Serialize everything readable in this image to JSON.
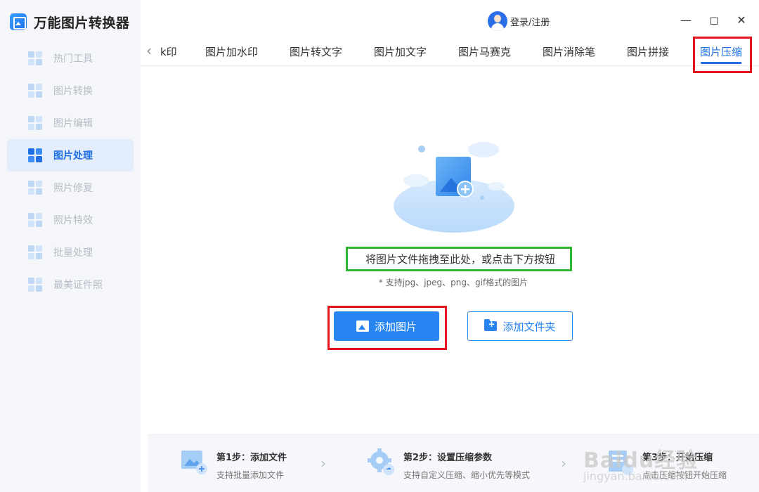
{
  "app": {
    "title": "万能图片转换器"
  },
  "header": {
    "login_label": "登录/注册"
  },
  "window_controls": {
    "minimize": "—",
    "maximize": "◻",
    "close": "✕"
  },
  "sidebar": {
    "items": [
      {
        "label": "热门工具",
        "active": false
      },
      {
        "label": "图片转换",
        "active": false
      },
      {
        "label": "图片编辑",
        "active": false
      },
      {
        "label": "图片处理",
        "active": true
      },
      {
        "label": "照片修复",
        "active": false
      },
      {
        "label": "照片特效",
        "active": false
      },
      {
        "label": "批量处理",
        "active": false
      },
      {
        "label": "最美证件照",
        "active": false
      }
    ]
  },
  "tabs": {
    "prev_icon": "‹",
    "items": [
      {
        "label": "k印"
      },
      {
        "label": "图片加水印"
      },
      {
        "label": "图片转文字"
      },
      {
        "label": "图片加文字"
      },
      {
        "label": "图片马赛克"
      },
      {
        "label": "图片消除笔"
      },
      {
        "label": "图片拼接"
      },
      {
        "label": "图片压缩",
        "active": true
      }
    ]
  },
  "main": {
    "drop_text": "将图片文件拖拽至此处，或点击下方按钮",
    "support_text": "* 支持jpg、jpeg、png、gif格式的图片",
    "add_image_label": "添加图片",
    "add_folder_label": "添加文件夹"
  },
  "steps": [
    {
      "title": "第1步：添加文件",
      "desc": "支持批量添加文件"
    },
    {
      "title": "第2步：设置压缩参数",
      "desc": "支持自定义压缩、缩小优先等模式"
    },
    {
      "title": "第3步：开始压缩",
      "desc": "点击压缩按钮开始压缩"
    }
  ],
  "watermark": {
    "text": "Baidu经验",
    "sub": "jingyan.baidu.com"
  },
  "colors": {
    "accent": "#1f6fe5",
    "highlight_red": "#e5131d",
    "highlight_green": "#2fb733"
  }
}
